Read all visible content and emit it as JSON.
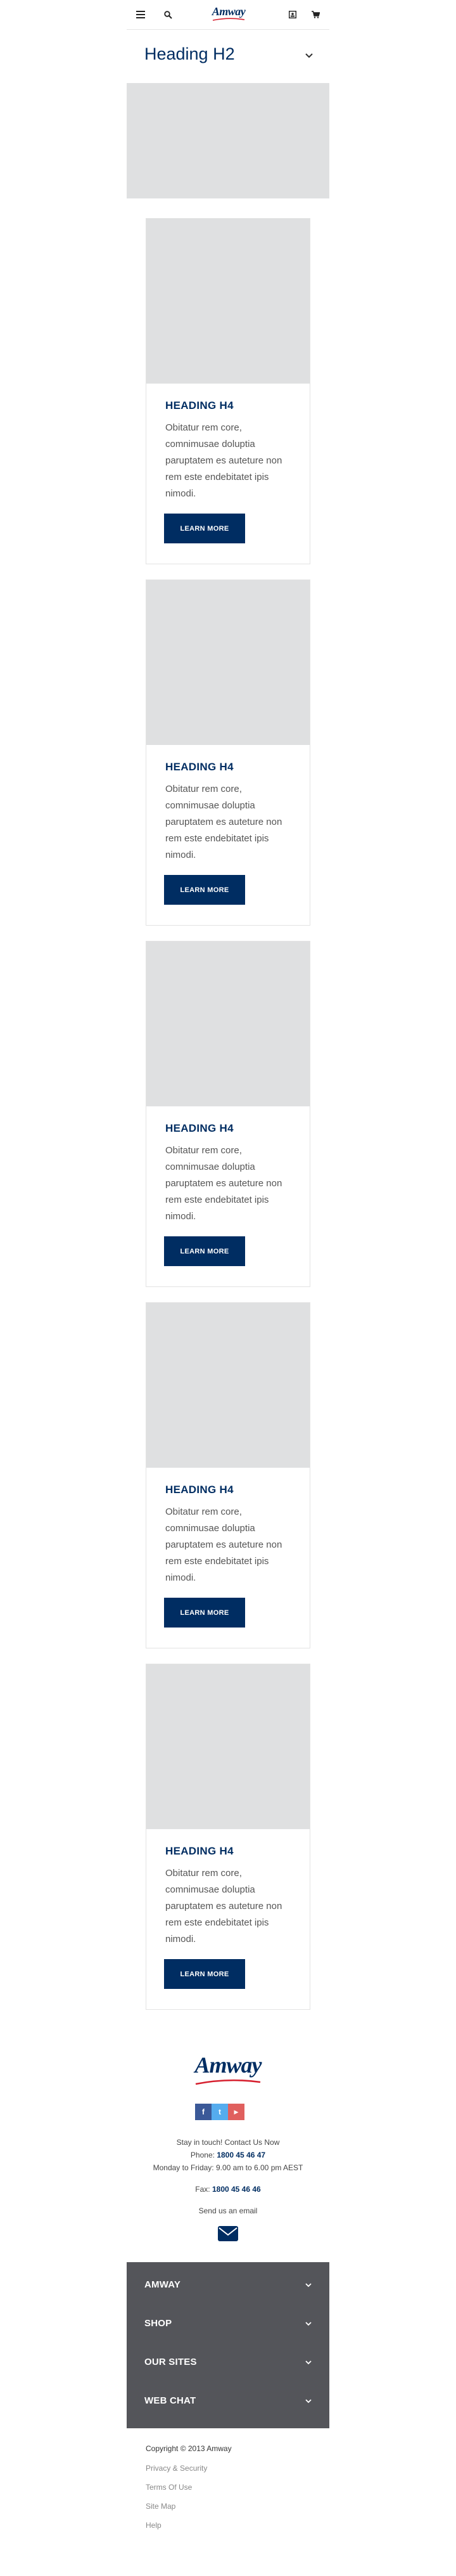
{
  "header": {
    "logo_text": "Amway",
    "icons": [
      "menu-icon",
      "search-icon",
      "logo",
      "account-icon",
      "cart-icon"
    ]
  },
  "section": {
    "heading": "Heading H2"
  },
  "cards": [
    {
      "title": "HEADING H4",
      "text": "Obitatur rem core, comnimusae doluptia paruptatem es auteture non rem este endebitatet ipis nimodi.",
      "button": "LEARN MORE"
    },
    {
      "title": "HEADING H4",
      "text": "Obitatur rem core, comnimusae doluptia paruptatem es auteture non rem este endebitatet ipis nimodi.",
      "button": "LEARN MORE"
    },
    {
      "title": "HEADING H4",
      "text": "Obitatur rem core, comnimusae doluptia paruptatem es auteture non rem este endebitatet ipis nimodi.",
      "button": "LEARN MORE"
    },
    {
      "title": "HEADING H4",
      "text": "Obitatur rem core, comnimusae doluptia paruptatem es auteture non rem este endebitatet ipis nimodi.",
      "button": "LEARN MORE"
    },
    {
      "title": "HEADING H4",
      "text": "Obitatur rem core, comnimusae doluptia paruptatem es auteture non rem este endebitatet ipis nimodi.",
      "button": "LEARN MORE"
    }
  ],
  "footer": {
    "logo_text": "Amway",
    "social": [
      {
        "name": "facebook-icon",
        "glyph": "f",
        "color": "#3b5998"
      },
      {
        "name": "twitter-icon",
        "glyph": "t",
        "color": "#55acee"
      },
      {
        "name": "youtube-icon",
        "glyph": "▶",
        "color": "#e0605e"
      }
    ],
    "stay_in_touch": "Stay in touch! Contact Us Now",
    "phone_label": "Phone:",
    "phone": "1800 45 46 47",
    "hours": "Monday to Friday: 9.00 am to 6.00 pm AEST",
    "fax_label": "Fax:",
    "fax": "1800 45 46 46",
    "email_label": "Send us an email",
    "accordion": [
      "AMWAY",
      "SHOP",
      "OUR SITES",
      "WEB CHAT"
    ],
    "copyright": "Copyright © 2013 Amway",
    "links": [
      "Privacy & Security",
      "Terms Of Use",
      "Site Map",
      "Help"
    ]
  },
  "colors": {
    "brand_navy": "#002d62",
    "placeholder_gray": "#dfe0e1",
    "footer_dark": "#54555a",
    "swoosh_red": "#d6202f"
  }
}
